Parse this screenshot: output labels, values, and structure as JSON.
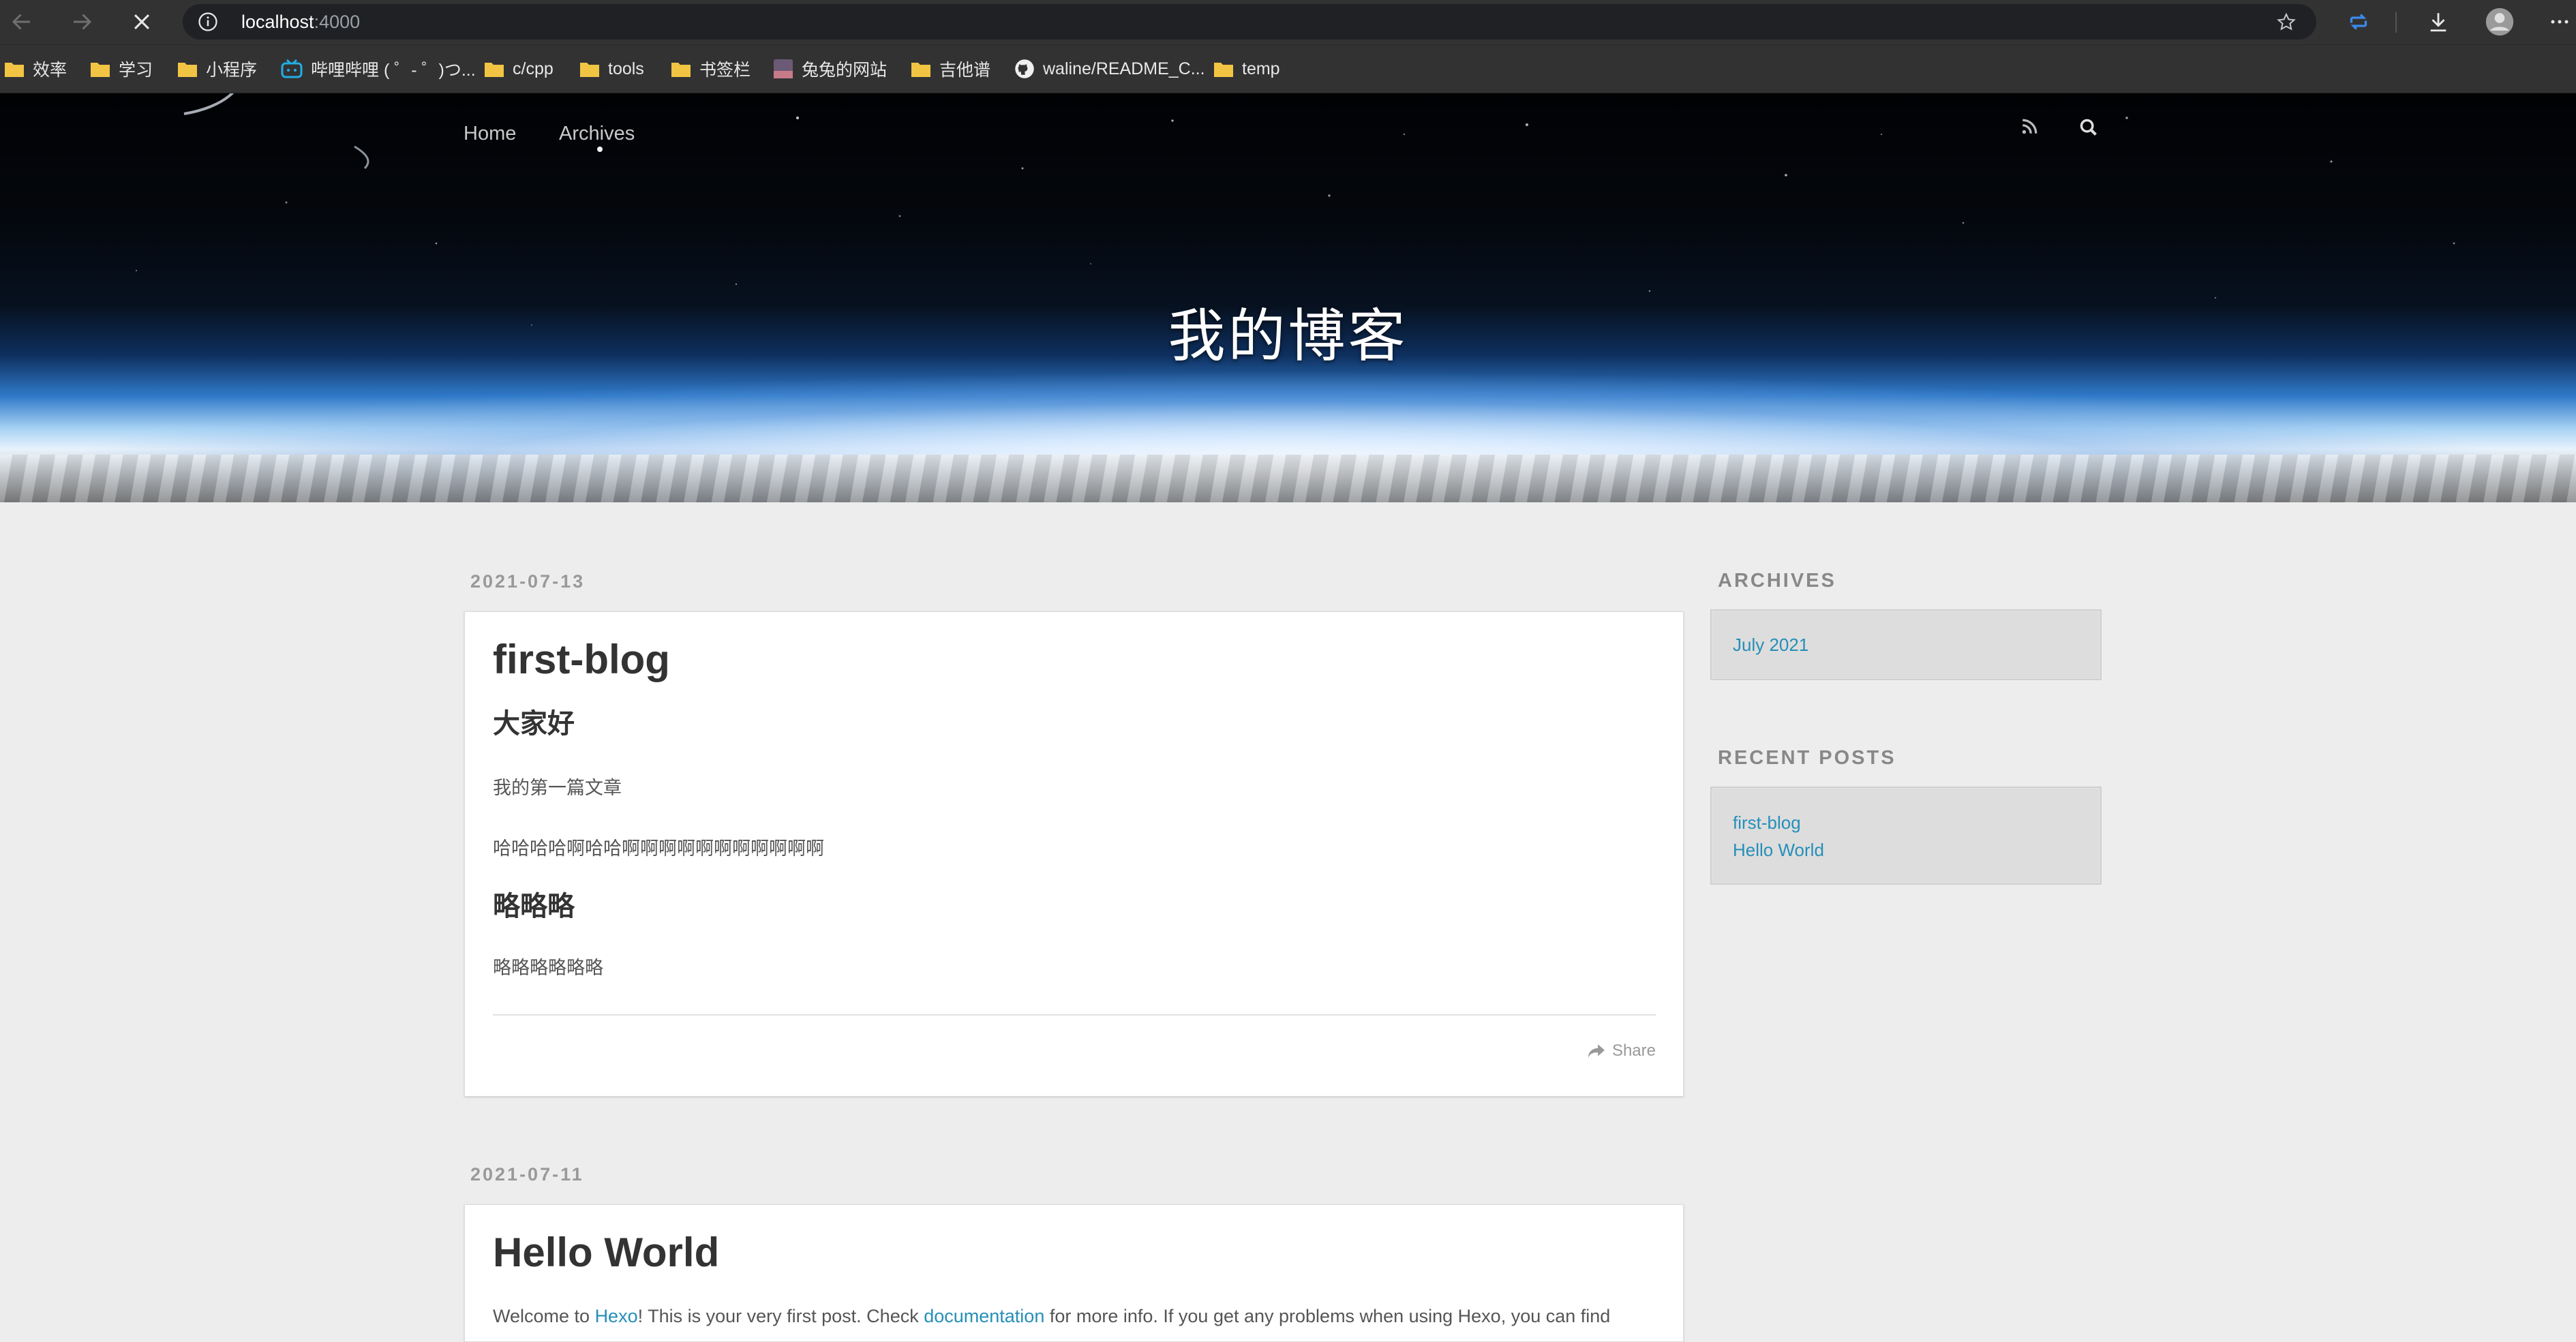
{
  "browser": {
    "url_host": "localhost",
    "url_port": ":4000",
    "bookmarks": [
      {
        "label": "效率",
        "icon": "folder-icon"
      },
      {
        "label": "学习",
        "icon": "folder-icon"
      },
      {
        "label": "小程序",
        "icon": "folder-icon"
      },
      {
        "label": "哔哩哔哩 ( ゜- ゜)つ...",
        "icon": "bilibili-icon"
      },
      {
        "label": "c/cpp",
        "icon": "folder-icon"
      },
      {
        "label": "tools",
        "icon": "folder-icon"
      },
      {
        "label": "书签栏",
        "icon": "folder-icon"
      },
      {
        "label": "兔兔的网站",
        "icon": "site-icon"
      },
      {
        "label": "吉他谱",
        "icon": "folder-icon"
      },
      {
        "label": "waline/README_C...",
        "icon": "github-icon"
      },
      {
        "label": "temp",
        "icon": "folder-icon"
      }
    ]
  },
  "site": {
    "title": "我的博客",
    "nav": {
      "home": "Home",
      "archives": "Archives"
    }
  },
  "posts": [
    {
      "date": "2021-07-13",
      "title": "first-blog",
      "h2_1": "大家好",
      "p1": "我的第一篇文章",
      "p2": "哈哈哈哈啊哈哈啊啊啊啊啊啊啊啊啊啊啊",
      "h2_2": "略略略",
      "p3": "略略略略略略",
      "share": "Share"
    },
    {
      "date": "2021-07-11",
      "title": "Hello World",
      "intro_1": "Welcome to ",
      "intro_link_1": "Hexo",
      "intro_2": "! This is your very first post. Check ",
      "intro_link_2": "documentation",
      "intro_3": " for more info. If you get any problems when using Hexo, you can find"
    }
  ],
  "sidebar": {
    "archives_title": "ARCHIVES",
    "archives": [
      "July 2021"
    ],
    "recent_title": "RECENT POSTS",
    "recent": [
      "first-blog",
      "Hello World"
    ]
  },
  "colors": {
    "link": "#258fb8",
    "accent_blue": "#3b8beb"
  }
}
